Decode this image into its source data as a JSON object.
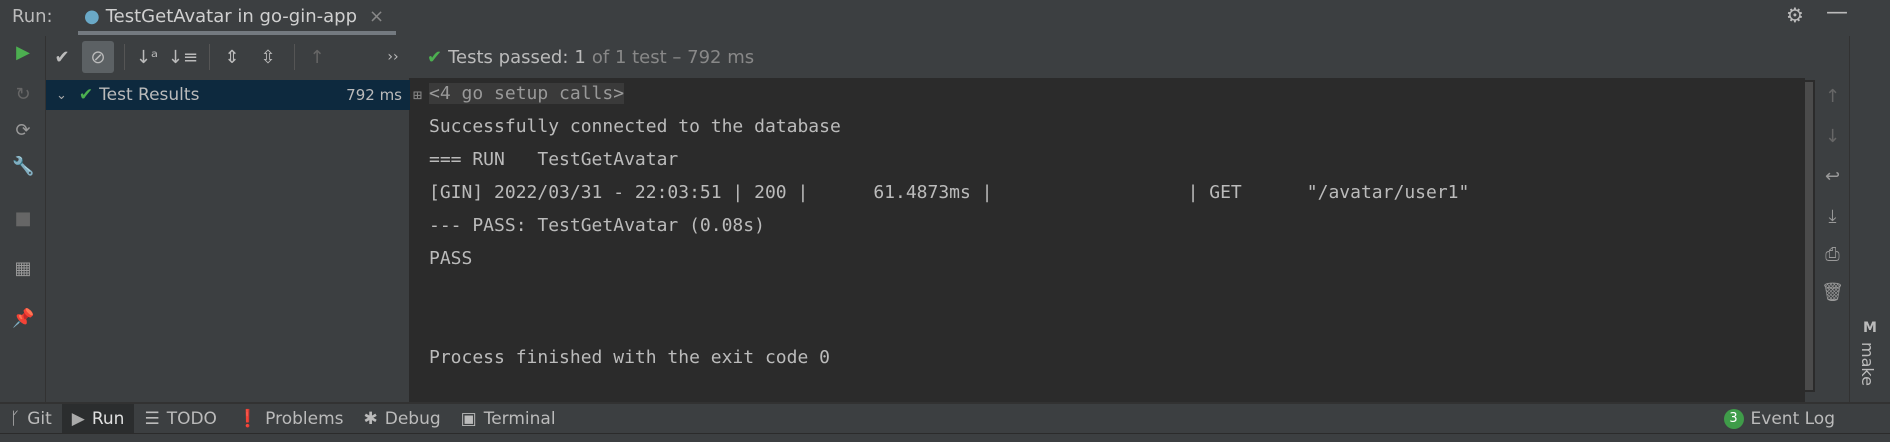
{
  "titlebar": {
    "run_label": "Run:",
    "tab_title": "TestGetAvatar in go-gin-app",
    "tab_close": "×"
  },
  "toolbar": {
    "status_prefix": "Tests passed:",
    "passed": "1",
    "status_suffix": "of 1 test – 792 ms",
    "overflow": "››"
  },
  "tree": {
    "root_label": "Test Results",
    "root_time": "792 ms"
  },
  "console": {
    "lines": [
      "<4 go setup calls>",
      "Successfully connected to the database",
      "=== RUN   TestGetAvatar",
      "[GIN] 2022/03/31 - 22:03:51 | 200 |      61.4873ms |                  | GET      \"/avatar/user1\"",
      "--- PASS: TestGetAvatar (0.08s)",
      "PASS",
      "Process finished with the exit code 0"
    ]
  },
  "right_strip": {
    "make_label": "make",
    "make_icon": "M"
  },
  "bottombar": {
    "tabs": [
      {
        "label": "Git",
        "icon": "git-branch"
      },
      {
        "label": "Run",
        "icon": "play",
        "active": true
      },
      {
        "label": "TODO",
        "icon": "list"
      },
      {
        "label": "Problems",
        "icon": "exclamation"
      },
      {
        "label": "Debug",
        "icon": "bug"
      },
      {
        "label": "Terminal",
        "icon": "terminal"
      }
    ],
    "event_log": "Event Log",
    "event_count": "3"
  },
  "colors": {
    "accent_green": "#4caf50",
    "selection": "#0d293e",
    "console_bg": "#2b2b2b"
  }
}
